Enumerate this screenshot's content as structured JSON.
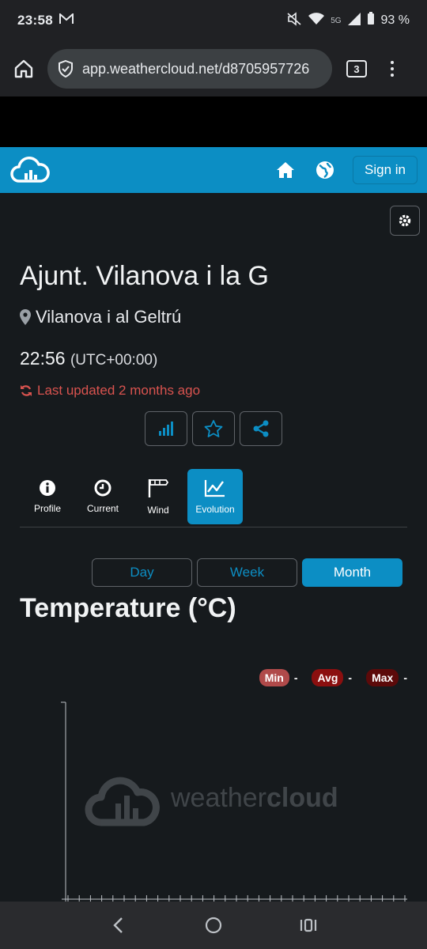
{
  "status": {
    "time": "23:58",
    "battery": "93 %",
    "network": "5G"
  },
  "browser": {
    "url": "app.weathercloud.net/d8705957726",
    "tab_count": "3"
  },
  "navbar": {
    "sign_in": "Sign in"
  },
  "station": {
    "title": "Ajunt. Vilanova i la G",
    "location": "Vilanova i al Geltrú",
    "time": "22:56",
    "timezone": "(UTC+00:00)",
    "last_updated": "Last updated 2 months ago"
  },
  "tabs": [
    {
      "label": "Profile"
    },
    {
      "label": "Current"
    },
    {
      "label": "Wind"
    },
    {
      "label": "Evolution"
    }
  ],
  "periods": [
    {
      "label": "Day"
    },
    {
      "label": "Week"
    },
    {
      "label": "Month"
    }
  ],
  "chart": {
    "title": "Temperature (°C)",
    "watermark_prefix": "weather",
    "watermark_suffix": "cloud",
    "legend": [
      {
        "label": "Min",
        "color": "#b04a4a",
        "value": "-"
      },
      {
        "label": "Avg",
        "color": "#8b0f0f",
        "value": "-"
      },
      {
        "label": "Max",
        "color": "#5c0a0a",
        "value": "-"
      }
    ]
  },
  "colors": {
    "accent": "#0c8ec4",
    "warning": "#d9534f"
  }
}
